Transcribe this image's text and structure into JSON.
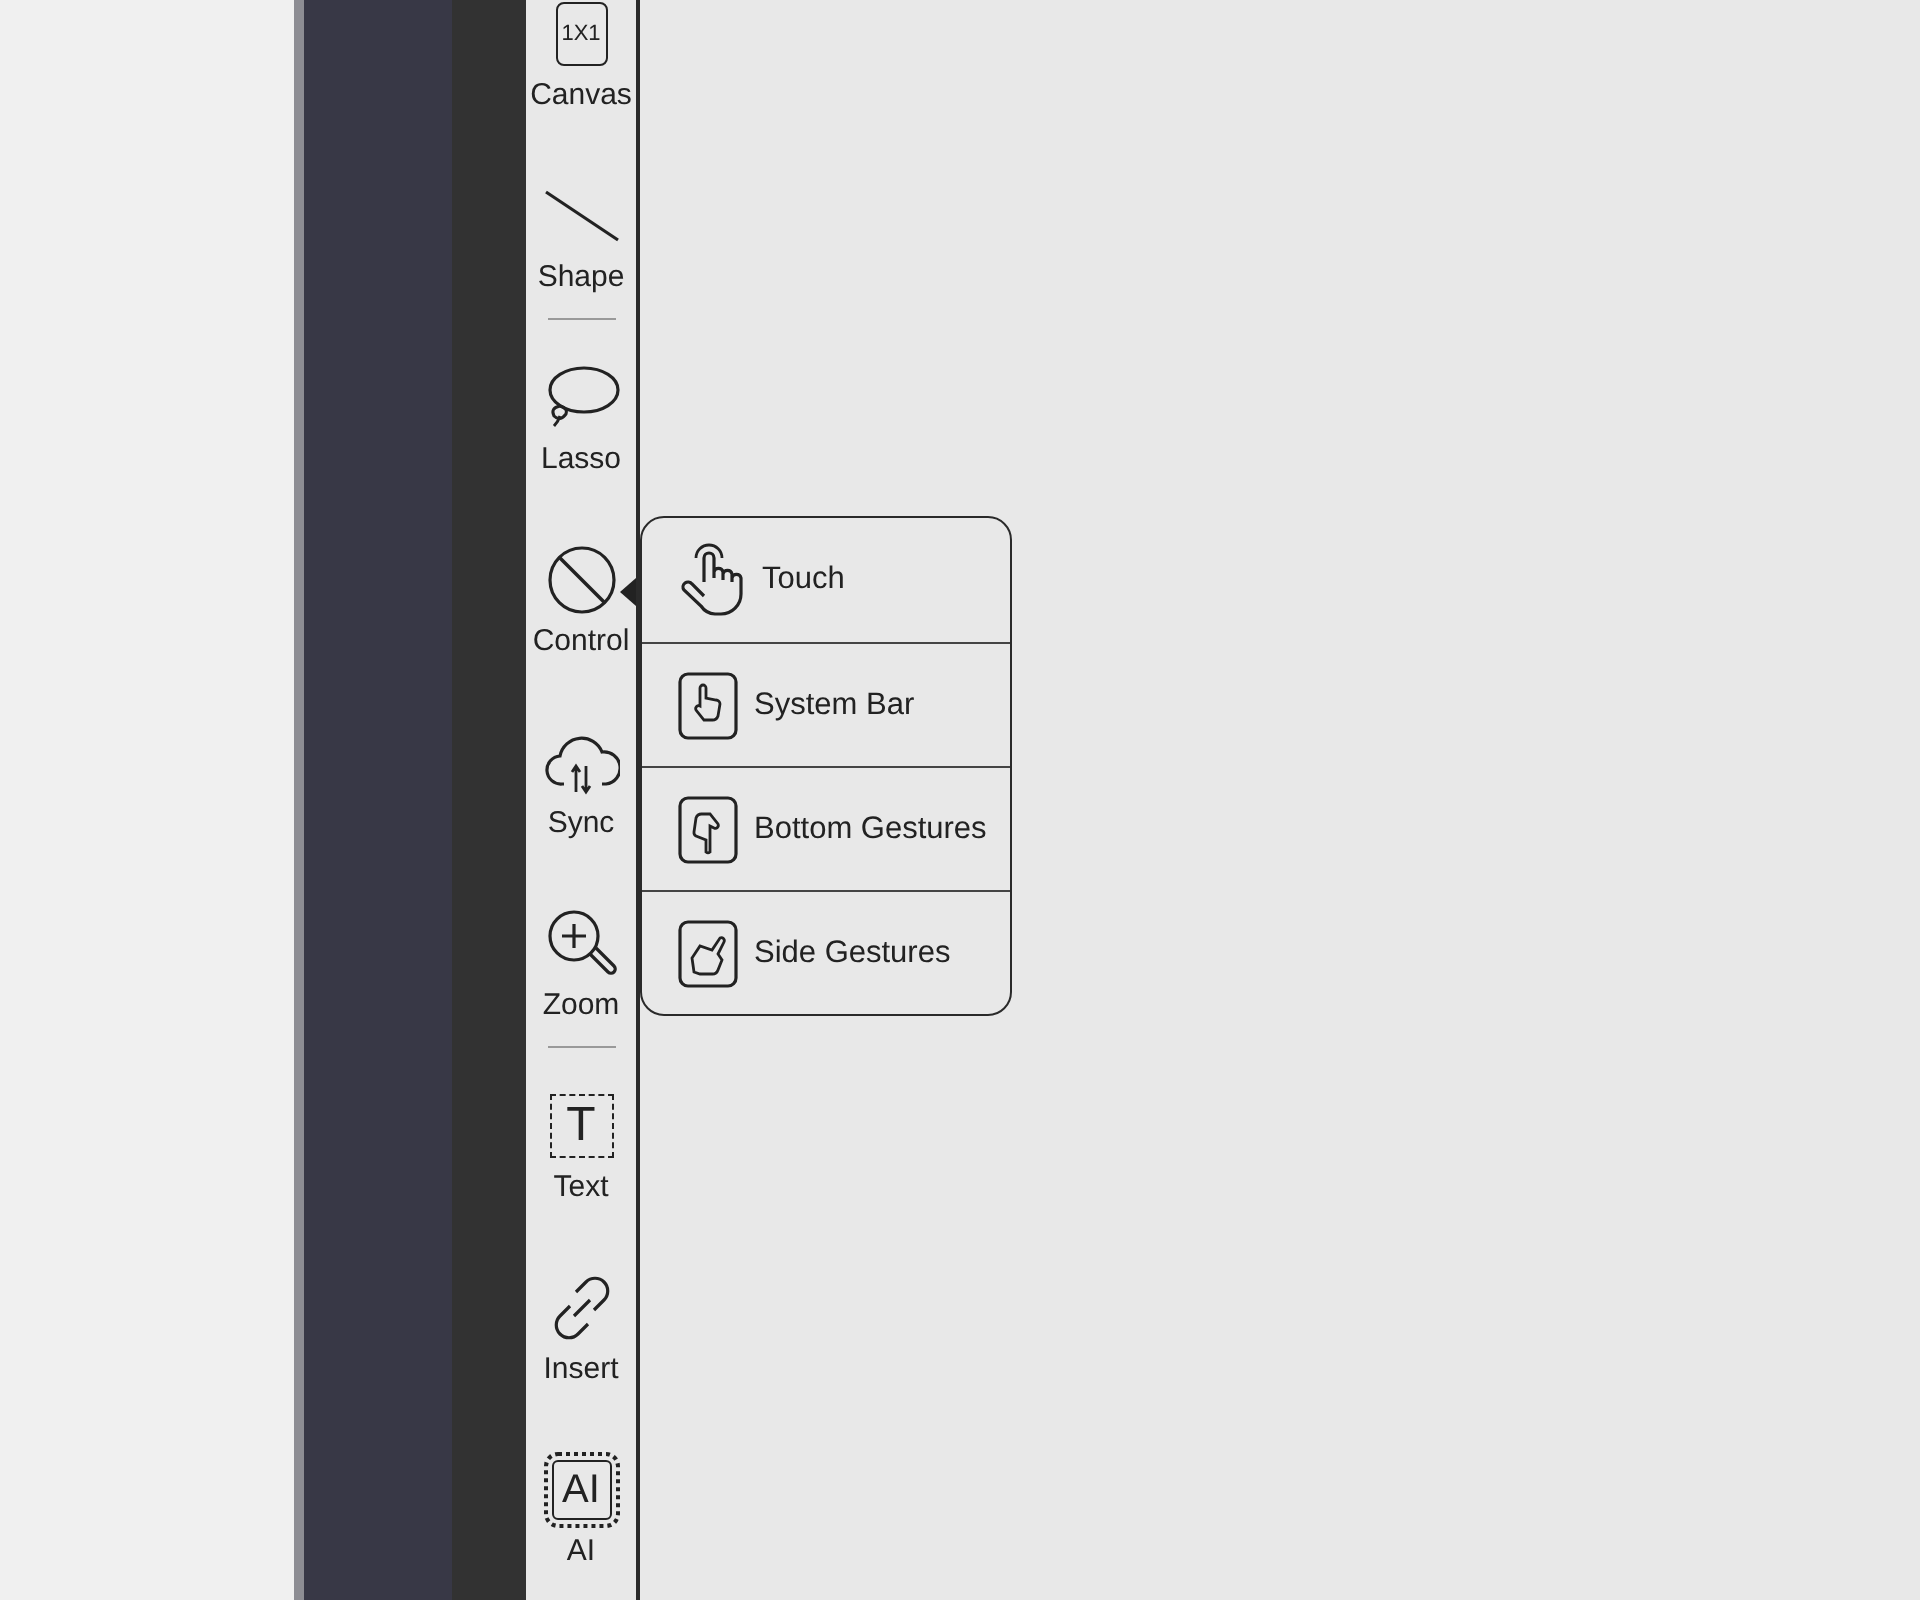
{
  "toolbar": {
    "items": [
      {
        "kind": "canvas",
        "label": "Canvas",
        "icon_text": "1X1",
        "selected": false
      },
      {
        "kind": "shape",
        "label": "Shape",
        "selected": false
      },
      {
        "kind": "separator"
      },
      {
        "kind": "lasso",
        "label": "Lasso",
        "selected": false
      },
      {
        "kind": "control",
        "label": "Control",
        "selected": true
      },
      {
        "kind": "sync",
        "label": "Sync",
        "selected": false
      },
      {
        "kind": "zoom",
        "label": "Zoom",
        "selected": false
      },
      {
        "kind": "separator"
      },
      {
        "kind": "text",
        "label": "Text",
        "icon_text": "T",
        "selected": false
      },
      {
        "kind": "insert",
        "label": "Insert",
        "selected": false
      },
      {
        "kind": "ai",
        "label": "AI",
        "icon_text": "AI",
        "selected": false
      }
    ]
  },
  "control_menu": {
    "items": [
      {
        "kind": "touch",
        "label": "Touch"
      },
      {
        "kind": "system_bar",
        "label": "System Bar"
      },
      {
        "kind": "bottom_gestures",
        "label": "Bottom Gestures"
      },
      {
        "kind": "side_gestures",
        "label": "Side Gestures"
      }
    ]
  }
}
